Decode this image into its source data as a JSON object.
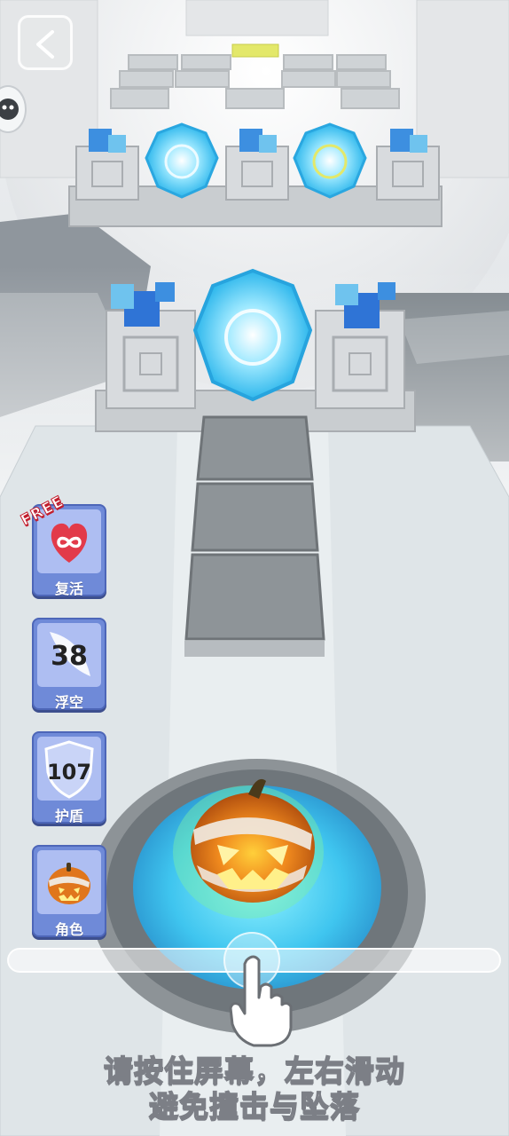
{
  "hud": {
    "back_icon": "chevron-left-icon",
    "side_icon": "ghost-icon"
  },
  "powerups": {
    "free_tag": "FREE",
    "revive_label": "复活",
    "float_count": "38",
    "float_label": "浮空",
    "shield_count": "107",
    "shield_label": "护盾",
    "character_label": "角色"
  },
  "instructions": {
    "line1": "请按住屏幕，左右滑动",
    "line2": "避免撞击与坠落"
  },
  "colors": {
    "button_bg": "#6f8ad8",
    "button_face": "#aebef2",
    "portal": "#37c6f2",
    "pumpkin": "#e0761c"
  }
}
